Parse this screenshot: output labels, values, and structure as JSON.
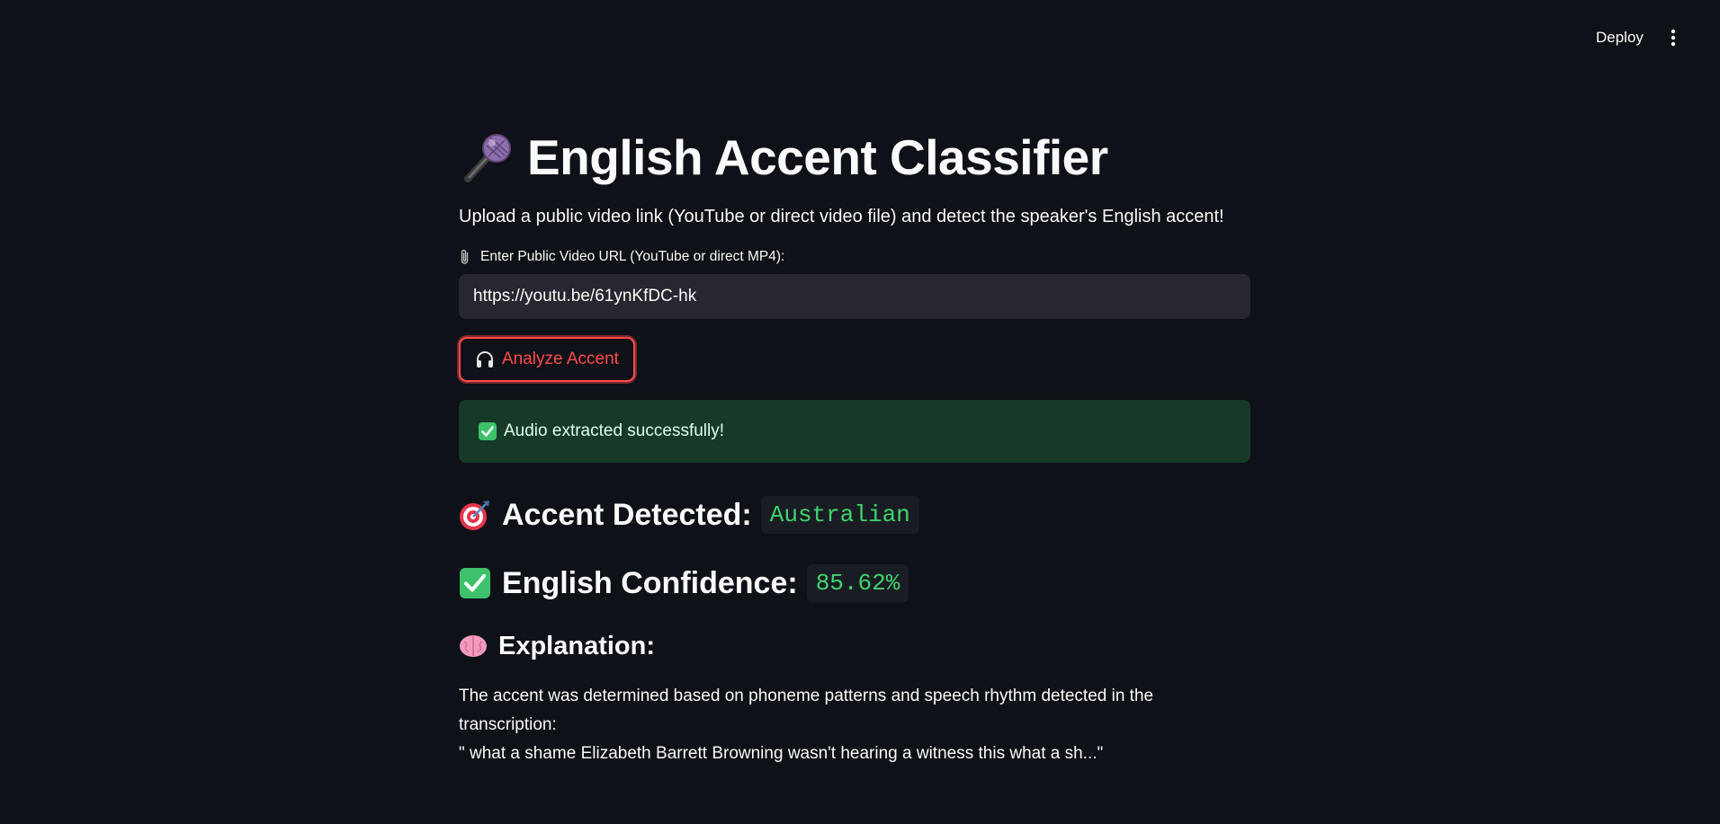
{
  "header": {
    "deploy_label": "Deploy",
    "menu_icon": "kebab-menu-icon"
  },
  "main": {
    "title": "English Accent Classifier",
    "title_icon": "microphone-icon",
    "subtitle": "Upload a public video link (YouTube or direct video file) and detect the speaker's English accent!",
    "url_field": {
      "label": "Enter Public Video URL (YouTube or direct MP4):",
      "label_icon": "paperclip-icon",
      "value": "https://youtu.be/61ynKfDC-hk"
    },
    "analyze_button": {
      "label": "Analyze Accent",
      "icon": "headphones-icon"
    },
    "success_message": "Audio extracted successfully!",
    "accent": {
      "label": "Accent Detected:",
      "value": "Australian",
      "icon": "target-icon"
    },
    "confidence": {
      "label": "English Confidence:",
      "value": "85.62%",
      "icon": "check-mark-icon"
    },
    "explanation": {
      "title": "Explanation:",
      "icon": "brain-icon",
      "line1": "The accent was determined based on phoneme patterns and speech rhythm detected in the transcription:",
      "line2": "\" what a shame Elizabeth Barrett Browning wasn't hearing a witness this what a sh...\""
    }
  },
  "colors": {
    "background": "#0e1117",
    "input_background": "#262730",
    "primary": "#ff4b4b",
    "success_background": "#173928",
    "code_text": "#3dd56d"
  }
}
